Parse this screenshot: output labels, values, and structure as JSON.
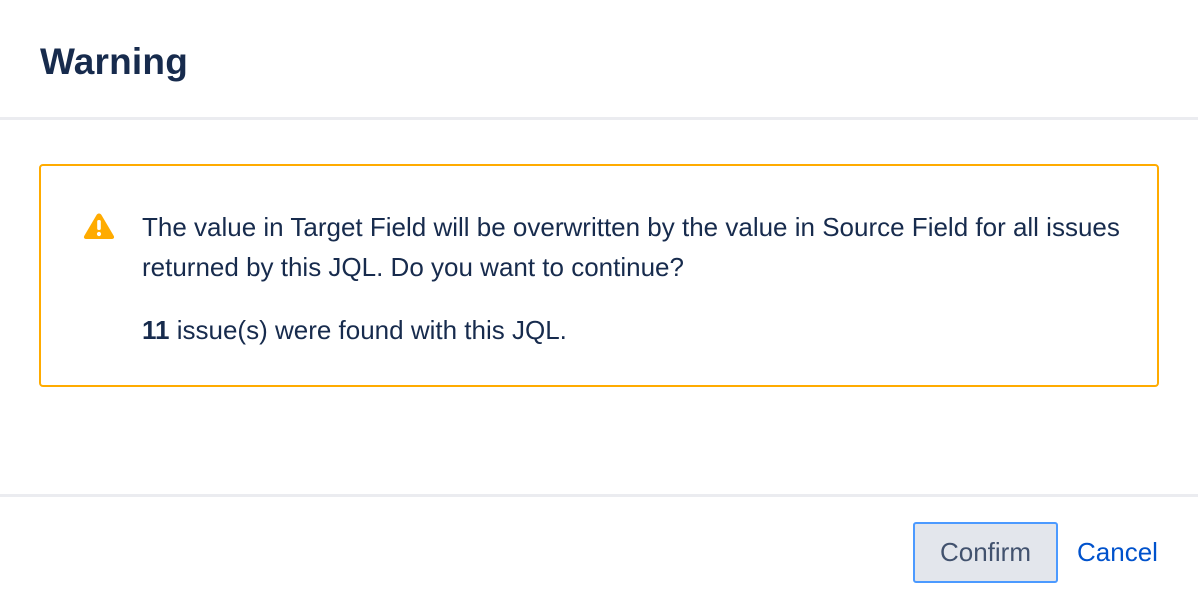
{
  "dialog": {
    "title": "Warning"
  },
  "warning": {
    "icon": "warning-icon",
    "accent_color": "#ffab00",
    "message": "The value in Target Field will be overwritten by the value in Source Field for all issues returned by this JQL. Do you want to continue?",
    "issue_count": "11",
    "issue_count_suffix": " issue(s) were found with this JQL."
  },
  "footer": {
    "confirm_label": "Confirm",
    "cancel_label": "Cancel"
  }
}
